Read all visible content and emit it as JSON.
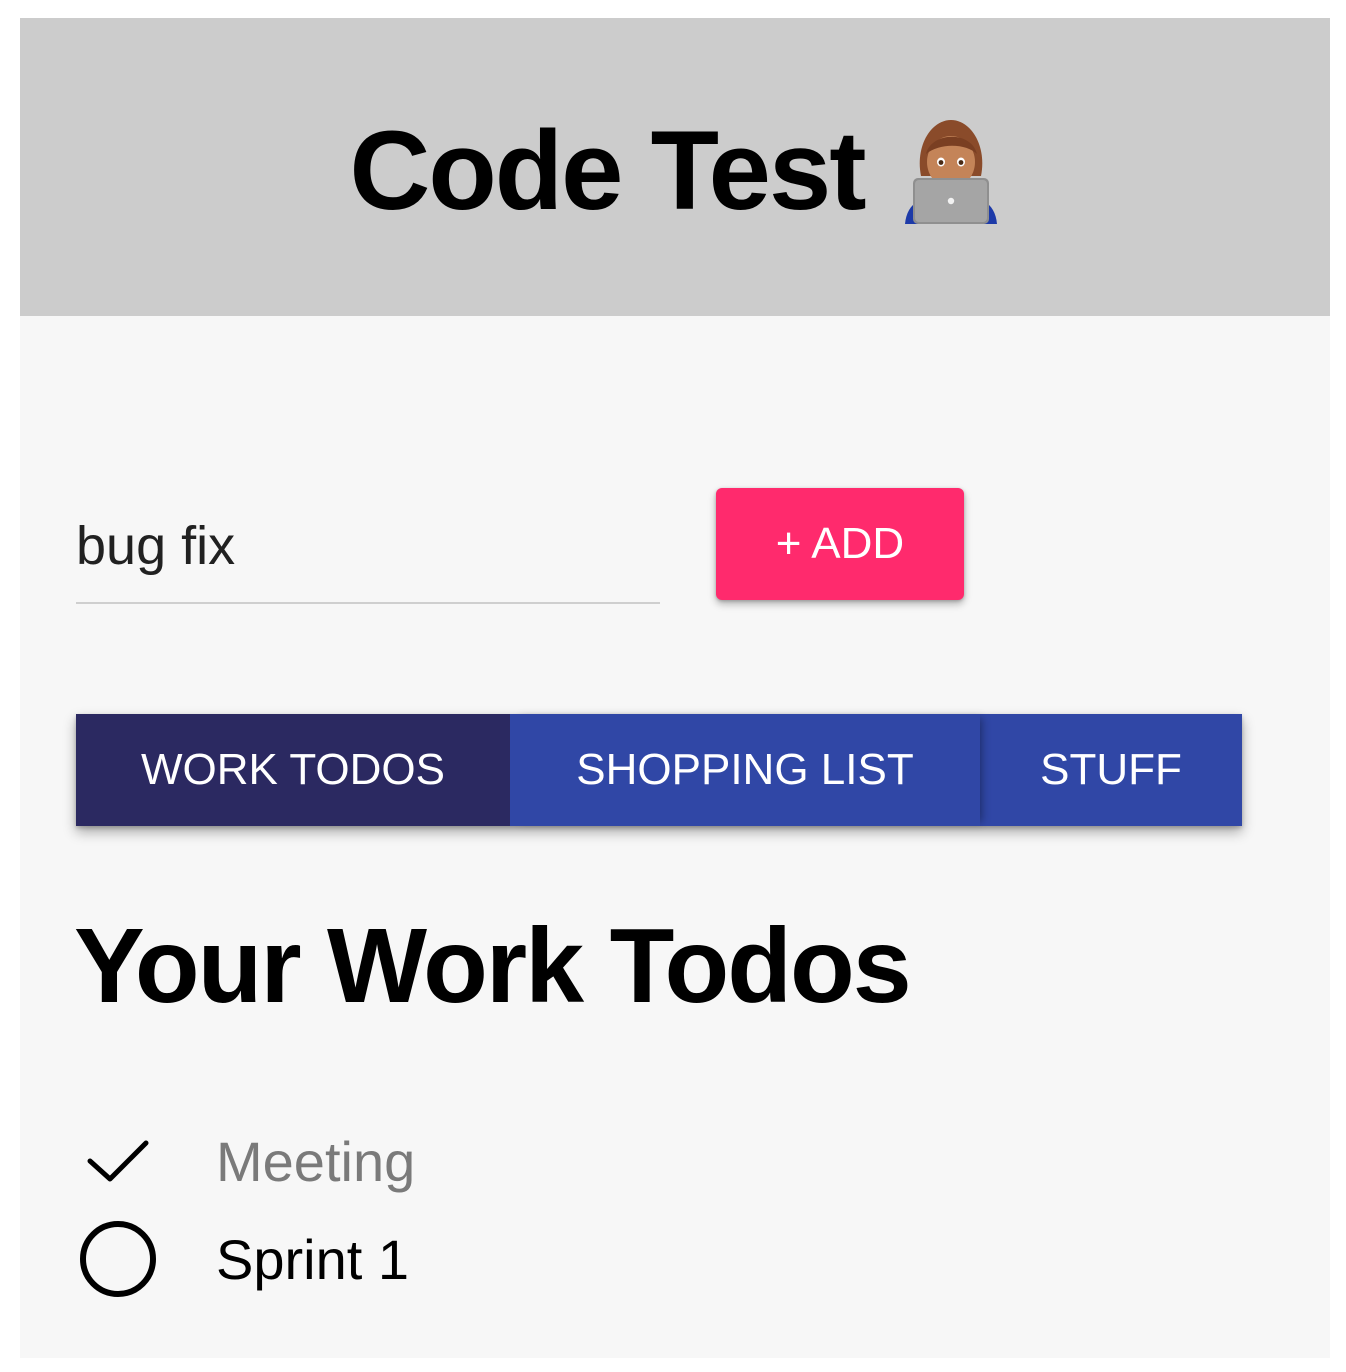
{
  "header": {
    "title": "Code Test",
    "emoji_icon": "woman-technologist-icon"
  },
  "form": {
    "input_value": "bug fix",
    "add_button_label": "+ ADD",
    "add_button_color": "#ff2a6d"
  },
  "tabs": [
    {
      "label": "WORK TODOS",
      "active": true
    },
    {
      "label": "SHOPPING LIST",
      "active": false
    },
    {
      "label": "STUFF",
      "active": false
    }
  ],
  "tab_colors": {
    "active": "#2b2961",
    "inactive": "#3047a6"
  },
  "section": {
    "title": "Your Work Todos"
  },
  "todos": [
    {
      "text": "Meeting",
      "completed": true,
      "icon": "checkmark-icon"
    },
    {
      "text": "Sprint 1",
      "completed": false,
      "icon": "empty-circle-icon"
    }
  ]
}
